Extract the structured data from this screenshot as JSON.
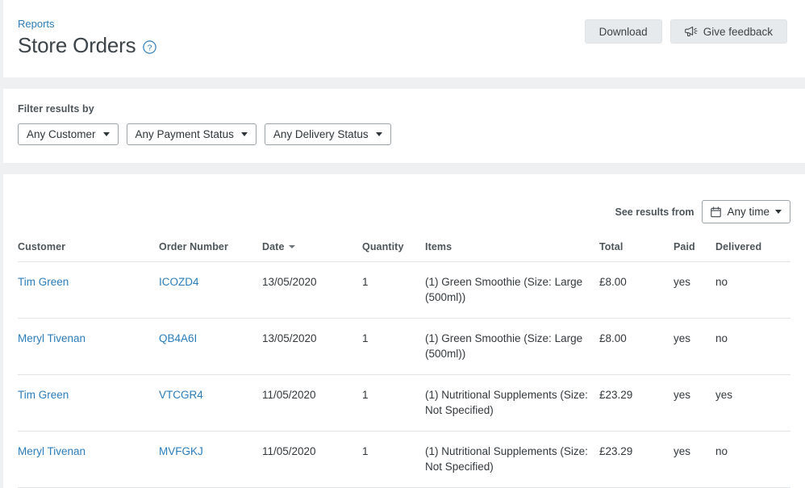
{
  "header": {
    "breadcrumb": "Reports",
    "title": "Store Orders",
    "help_icon": "question-circle-icon",
    "download_label": "Download",
    "feedback_label": "Give feedback",
    "feedback_icon": "megaphone-icon"
  },
  "filters": {
    "label": "Filter results by",
    "options": [
      {
        "label": "Any Customer"
      },
      {
        "label": "Any Payment Status"
      },
      {
        "label": "Any Delivery Status"
      }
    ]
  },
  "results": {
    "see_results_label": "See results from",
    "date_filter": "Any time",
    "date_icon": "calendar-icon",
    "columns": [
      "Customer",
      "Order Number",
      "Date",
      "Quantity",
      "Items",
      "Total",
      "Paid",
      "Delivered"
    ],
    "sorted_column": "Date",
    "sort_direction": "desc",
    "rows": [
      {
        "customer": "Tim Green",
        "order_number": "ICOZD4",
        "date": "13/05/2020",
        "quantity": "1",
        "items": "(1) Green Smoothie (Size: Large (500ml))",
        "total": "£8.00",
        "paid": "yes",
        "delivered": "no"
      },
      {
        "customer": "Meryl Tivenan",
        "order_number": "QB4A6I",
        "date": "13/05/2020",
        "quantity": "1",
        "items": "(1) Green Smoothie (Size: Large (500ml))",
        "total": "£8.00",
        "paid": "yes",
        "delivered": "no"
      },
      {
        "customer": "Tim Green",
        "order_number": "VTCGR4",
        "date": "11/05/2020",
        "quantity": "1",
        "items": "(1) Nutritional Supplements (Size: Not Specified)",
        "total": "£23.29",
        "paid": "yes",
        "delivered": "yes"
      },
      {
        "customer": "Meryl Tivenan",
        "order_number": "MVFGKJ",
        "date": "11/05/2020",
        "quantity": "1",
        "items": "(1) Nutritional Supplements (Size: Not Specified)",
        "total": "£23.29",
        "paid": "yes",
        "delivered": "no"
      }
    ]
  },
  "colors": {
    "link": "#2b7cb9",
    "negative": "#e8434f",
    "page_bg": "#eef0f2",
    "card_bg": "#ffffff",
    "text": "#32383c"
  }
}
